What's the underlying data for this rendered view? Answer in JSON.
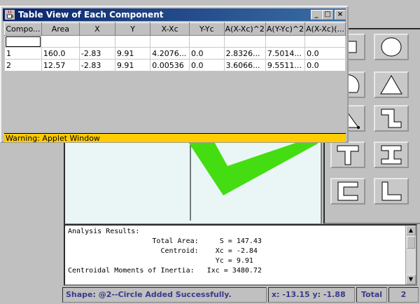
{
  "window": {
    "title": "Table View of Each Component",
    "minimize_glyph": "_",
    "maximize_glyph": "□",
    "close_glyph": "×",
    "warning": "Warning: Applet Window"
  },
  "table": {
    "columns": [
      "Compo...",
      "Area",
      "X",
      "Y",
      "X-Xc",
      "Y-Yc",
      "A(X-Xc)^2",
      "A(Y-Yc)^2",
      "A(X-Xc)(..."
    ],
    "rows": [
      [
        "1",
        "160.0",
        "-2.83",
        "9.91",
        "4.2076...",
        "0.0",
        "2.8326...",
        "7.5014...",
        "0.0"
      ],
      [
        "2",
        "12.57",
        "-2.83",
        "9.91",
        "0.00536",
        "0.0",
        "3.6066...",
        "9.5511...",
        "0.0"
      ]
    ]
  },
  "palette": {
    "buttons": [
      "rectangle-icon",
      "circle-icon",
      "half-circle-icon",
      "triangle-icon",
      "quarter-circle-icon",
      "z-section-icon",
      "t-section-icon",
      "i-beam-icon",
      "channel-icon",
      "angle-icon"
    ]
  },
  "results": {
    "lines": [
      "Analysis Results:",
      "                    Total Area:     S = 147.43",
      "                      Centroid:    Xc = -2.84",
      "                                   Yc = 9.91",
      "Centroidal Moments of Inertia:   Ixc = 3480.72"
    ]
  },
  "status": {
    "message": "Shape: @2--Circle  Added Successfully.",
    "coords": "x: -13.15   y: -1.88",
    "total_label": "Total",
    "total_value": "2"
  },
  "colors": {
    "shape_fill": "#44dd11",
    "canvas_bg": "#eaf6f6",
    "title_start": "#0a246a",
    "warning_bg": "#ffcc00",
    "status_text": "#3a3a8a"
  }
}
